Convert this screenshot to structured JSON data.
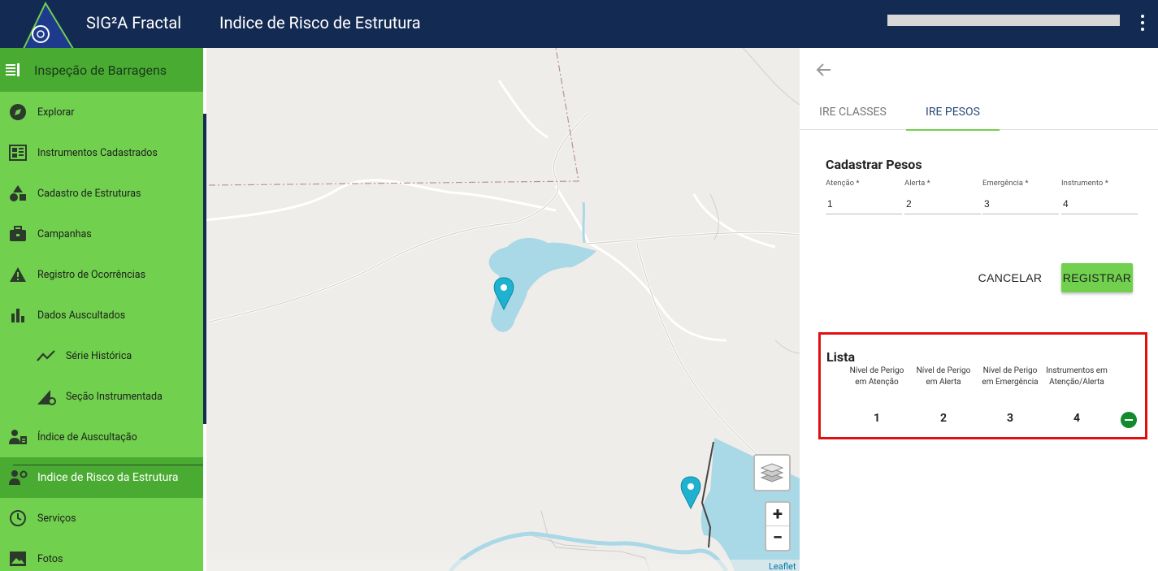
{
  "header": {
    "app_name": "SIG²A Fractal",
    "page_title": "Indice de Risco de Estrutura",
    "colors": {
      "bar": "#132a52",
      "accent": "#71d14e"
    }
  },
  "sidebar": {
    "section_title": "Inspeção de Barragens",
    "items": [
      {
        "label": "Explorar",
        "icon": "compass-icon"
      },
      {
        "label": "Instrumentos Cadastrados",
        "icon": "dashboard-icon"
      },
      {
        "label": "Cadastro de Estruturas",
        "icon": "shapes-icon"
      },
      {
        "label": "Campanhas",
        "icon": "briefcase-icon"
      },
      {
        "label": "Registro de Ocorrências",
        "icon": "warning-icon"
      },
      {
        "label": "Dados Auscultados",
        "icon": "bar-chart-icon"
      },
      {
        "label": "Série Histórica",
        "icon": "trend-icon"
      },
      {
        "label": "Seção Instrumentada",
        "icon": "section-gear-icon"
      },
      {
        "label": "Índice de Auscultação",
        "icon": "worker-icon"
      },
      {
        "label": "Indice de Risco da Estrutura",
        "icon": "worker-gear-icon"
      },
      {
        "label": "Serviços",
        "icon": "clock-icon"
      },
      {
        "label": "Fotos",
        "icon": "image-icon"
      }
    ]
  },
  "map": {
    "attribution": "Leaflet",
    "zoom_in": "+",
    "zoom_out": "−"
  },
  "panel": {
    "tabs": [
      "IRE CLASSES",
      "IRE PESOS"
    ],
    "form_title": "Cadastrar Pesos",
    "fields": [
      {
        "label": "Atenção *",
        "value": "1"
      },
      {
        "label": "Alerta *",
        "value": "2"
      },
      {
        "label": "Emergência *",
        "value": "3"
      },
      {
        "label": "Instrumento *",
        "value": "4"
      }
    ],
    "cancel_label": "CANCELAR",
    "register_label": "REGISTRAR",
    "list": {
      "title": "Lista",
      "headers": [
        [
          "Nível de Perigo",
          "em Atenção"
        ],
        [
          "Nível de Perigo",
          "em Alerta"
        ],
        [
          "Nível de Perigo",
          "em Emergência"
        ],
        [
          "Instrumentos em",
          "Atenção/Alerta"
        ]
      ],
      "row": [
        "1",
        "2",
        "3",
        "4"
      ]
    }
  }
}
